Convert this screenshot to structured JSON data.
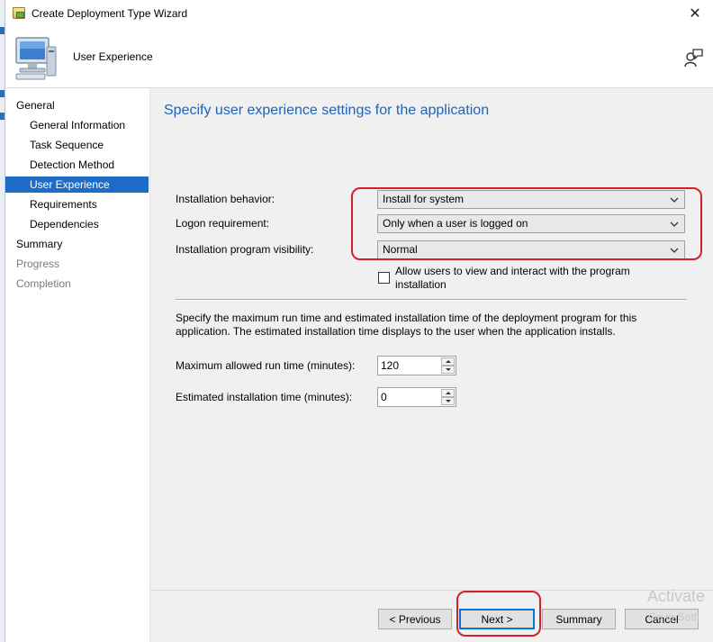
{
  "window": {
    "title": "Create Deployment Type Wizard",
    "close_symbol": "✕"
  },
  "header": {
    "title": "User Experience",
    "icon": "computer-icon",
    "help_icon": "help-person-icon"
  },
  "nav": {
    "items": [
      {
        "label": "General",
        "level": 1,
        "state": "normal"
      },
      {
        "label": "General Information",
        "level": 2,
        "state": "normal"
      },
      {
        "label": "Task Sequence",
        "level": 2,
        "state": "normal"
      },
      {
        "label": "Detection Method",
        "level": 2,
        "state": "normal"
      },
      {
        "label": "User Experience",
        "level": 2,
        "state": "selected"
      },
      {
        "label": "Requirements",
        "level": 2,
        "state": "normal"
      },
      {
        "label": "Dependencies",
        "level": 2,
        "state": "normal"
      },
      {
        "label": "Summary",
        "level": 1,
        "state": "normal"
      },
      {
        "label": "Progress",
        "level": 1,
        "state": "disabled"
      },
      {
        "label": "Completion",
        "level": 1,
        "state": "disabled"
      }
    ]
  },
  "main": {
    "page_title": "Specify user experience settings for the application",
    "installation_behavior": {
      "label": "Installation behavior:",
      "value": "Install for system"
    },
    "logon_requirement": {
      "label": "Logon requirement:",
      "value": "Only when a user is logged on"
    },
    "program_visibility": {
      "label": "Installation program visibility:",
      "value": "Normal"
    },
    "allow_interact": {
      "line1": "Allow users to view and interact with the program",
      "line2": "installation",
      "checked": false
    },
    "description_line1": "Specify the maximum run time and estimated installation time of the deployment program for this",
    "description_line2": "application. The estimated installation time displays to the user when the application installs.",
    "max_run_time": {
      "label": "Maximum allowed run time (minutes):",
      "value": "120"
    },
    "est_install_time": {
      "label": "Estimated installation time (minutes):",
      "value": "0"
    }
  },
  "buttons": {
    "previous": "< Previous",
    "next": "Next >",
    "summary": "Summary",
    "cancel": "Cancel"
  },
  "watermark": {
    "line1": "Activate",
    "line2": "Go to Setti"
  },
  "colors": {
    "accent": "#1f6cc6",
    "title_blue": "#1f64b4",
    "annotation_red": "#d4202b"
  }
}
